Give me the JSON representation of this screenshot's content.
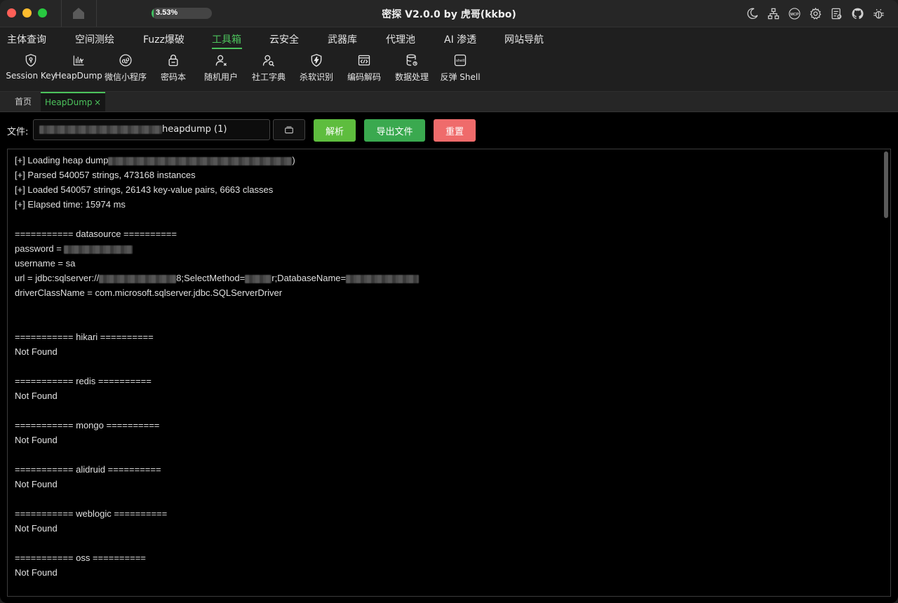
{
  "window": {
    "title": "密探 V2.0.0 by 虎哥(kkbo)",
    "progress_text": "3.53%",
    "progress_value": 3.53
  },
  "titlebar_icons": [
    "moon-icon",
    "network-icon",
    "mcp-icon",
    "gear-icon",
    "document-icon",
    "github-icon",
    "bug-icon"
  ],
  "menu": {
    "items": [
      {
        "label": "主体查询"
      },
      {
        "label": "空间测绘"
      },
      {
        "label": "Fuzz爆破"
      },
      {
        "label": "工具箱"
      },
      {
        "label": "云安全"
      },
      {
        "label": "武器库"
      },
      {
        "label": "代理池"
      },
      {
        "label": "AI 渗透"
      },
      {
        "label": "网站导航"
      }
    ],
    "active_index": 3
  },
  "toolbar": {
    "items": [
      {
        "label": "Session Key",
        "icon": "key-shield-icon"
      },
      {
        "label": "HeapDump",
        "icon": "chart-icon"
      },
      {
        "label": "微信小程序",
        "icon": "mini-program-icon"
      },
      {
        "label": "密码本",
        "icon": "lock-icon"
      },
      {
        "label": "随机用户",
        "icon": "user-icon"
      },
      {
        "label": "社工字典",
        "icon": "user-search-icon"
      },
      {
        "label": "杀软识别",
        "icon": "shield-bolt-icon"
      },
      {
        "label": "编码解码",
        "icon": "code-window-icon"
      },
      {
        "label": "数据处理",
        "icon": "database-icon"
      },
      {
        "label": "反弹 Shell",
        "icon": "shell-icon"
      }
    ]
  },
  "tabs": {
    "home": "首页",
    "active": "HeapDump",
    "close": "×"
  },
  "form": {
    "file_label": "文件:",
    "file_value_visible": "heapdump (1)",
    "parse_button": "解析",
    "export_button": "导出文件",
    "reset_button": "重置"
  },
  "output": {
    "lines": [
      "[+] Loading heap dump",
      "[+] Parsed 540057 strings, 473168 instances",
      "[+] Loaded 540057 strings, 26143 key-value pairs, 6663 classes",
      "[+] Elapsed time: 15974 ms",
      "",
      "=========== datasource ==========",
      "password = ",
      "username = sa",
      "url = jdbc:sqlserver://",
      "driverClassName = com.microsoft.sqlserver.jdbc.SQLServerDriver",
      "",
      "",
      "=========== hikari ==========",
      "Not Found",
      "",
      "=========== redis ==========",
      "Not Found",
      "",
      "=========== mongo ==========",
      "Not Found",
      "",
      "=========== alidruid ==========",
      "Not Found",
      "",
      "=========== weblogic ==========",
      "Not Found",
      "",
      "=========== oss ==========",
      "Not Found"
    ],
    "url_fragment_1": "8;SelectMethod=",
    "url_fragment_2": "r;DatabaseName=",
    "loading_suffix": ")"
  },
  "colors": {
    "accent": "#4cc35c",
    "parse": "#5ebd3e",
    "export": "#3aa94f",
    "reset": "#ef6b6b"
  }
}
